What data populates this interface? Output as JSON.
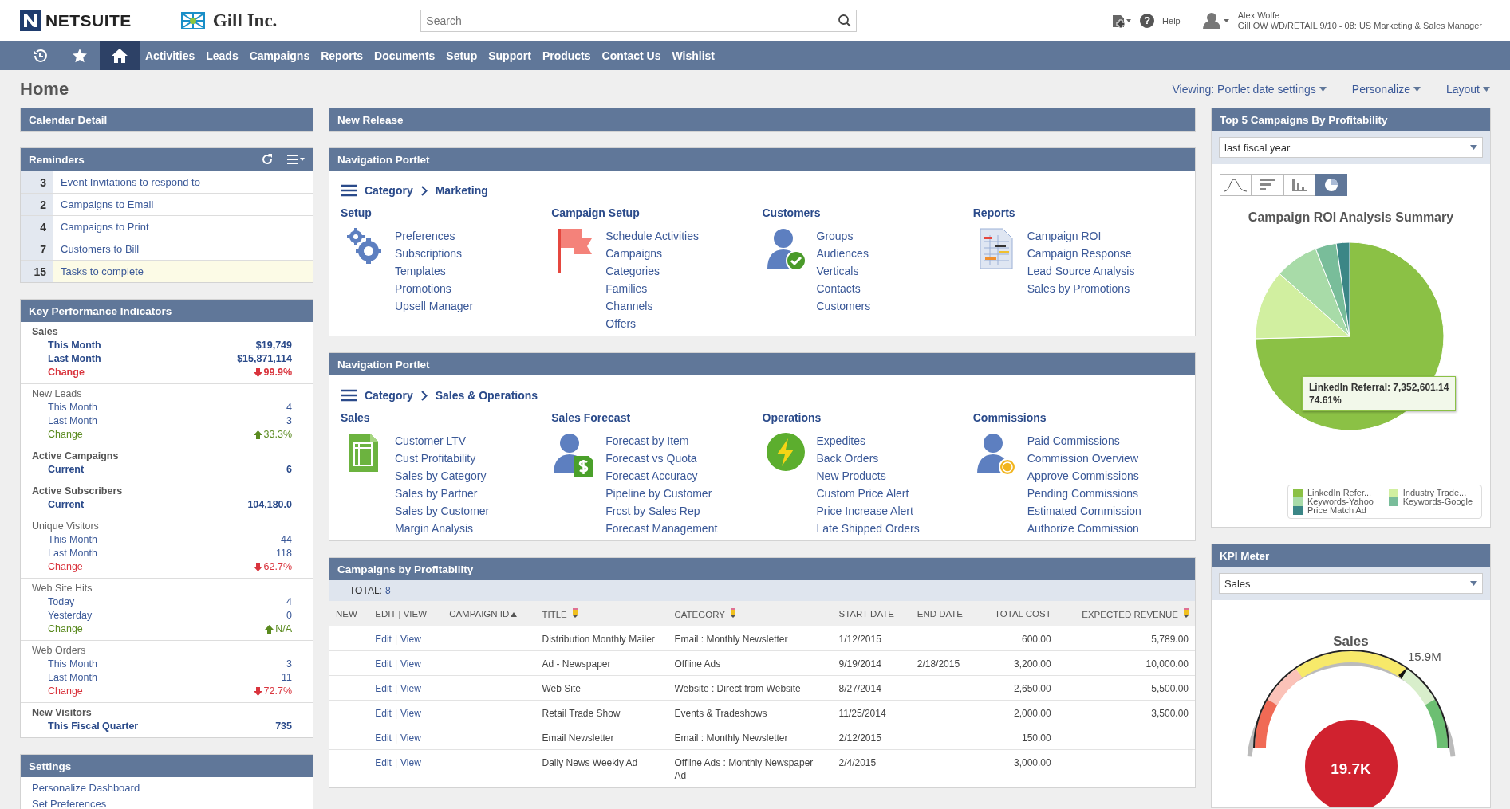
{
  "header": {
    "brand": "NETSUITE",
    "company": "Gill Inc.",
    "search": {
      "placeholder": "Search"
    },
    "help_icon": "?",
    "help": "Help",
    "user": {
      "name": "Alex Wolfe",
      "role": "Gill OW WD/RETAIL 9/10 - 08: US Marketing & Sales Manager"
    }
  },
  "nav": {
    "icons": [
      {
        "kind": "recent",
        "selected": false
      },
      {
        "kind": "favorites",
        "selected": false
      },
      {
        "kind": "home",
        "selected": true
      }
    ],
    "items": [
      {
        "label": "Activities",
        "selected": false
      },
      {
        "label": "Leads",
        "selected": false
      },
      {
        "label": "Campaigns",
        "selected": false
      },
      {
        "label": "Reports",
        "selected": false
      },
      {
        "label": "Documents",
        "selected": false
      },
      {
        "label": "Setup",
        "selected": false
      },
      {
        "label": "Support",
        "selected": false
      },
      {
        "label": "Products",
        "selected": false
      },
      {
        "label": "Contact Us",
        "selected": false
      },
      {
        "label": "Wishlist",
        "selected": false
      }
    ]
  },
  "page": {
    "title": "Home",
    "links": [
      "Viewing: Portlet date settings",
      "Personalize",
      "Layout"
    ]
  },
  "calendar": {
    "title": "Calendar Detail"
  },
  "reminders": {
    "title": "Reminders",
    "items": [
      {
        "count": "3",
        "label": "Event Invitations to respond to",
        "highlighted": false
      },
      {
        "count": "2",
        "label": "Campaigns to Email",
        "highlighted": false
      },
      {
        "count": "4",
        "label": "Campaigns to Print",
        "highlighted": false
      },
      {
        "count": "7",
        "label": "Customers to Bill",
        "highlighted": false
      },
      {
        "count": "15",
        "label": "Tasks to complete",
        "highlighted": true
      }
    ]
  },
  "kpi": {
    "title": "Key Performance Indicators",
    "groups": [
      {
        "title": "Sales",
        "emphasis": true,
        "rows": [
          {
            "label": "This Month",
            "value": "$19,749"
          },
          {
            "label": "Last Month",
            "value": "$15,871,114"
          },
          {
            "label": "Change",
            "value": "99.9%",
            "kind": "down"
          }
        ]
      },
      {
        "title": "New Leads",
        "emphasis": false,
        "rows": [
          {
            "label": "This Month",
            "value": "4"
          },
          {
            "label": "Last Month",
            "value": "3"
          },
          {
            "label": "Change",
            "value": "33.3%",
            "kind": "up"
          }
        ]
      },
      {
        "title": "Active Campaigns",
        "emphasis": true,
        "rows": [
          {
            "label": "Current",
            "value": "6"
          }
        ]
      },
      {
        "title": "Active Subscribers",
        "emphasis": true,
        "rows": [
          {
            "label": "Current",
            "value": "104,180.0"
          }
        ]
      },
      {
        "title": "Unique Visitors",
        "emphasis": false,
        "rows": [
          {
            "label": "This Month",
            "value": "44"
          },
          {
            "label": "Last Month",
            "value": "118"
          },
          {
            "label": "Change",
            "value": "62.7%",
            "kind": "down"
          }
        ]
      },
      {
        "title": "Web Site Hits",
        "emphasis": false,
        "rows": [
          {
            "label": "Today",
            "value": "4"
          },
          {
            "label": "Yesterday",
            "value": "0"
          },
          {
            "label": "Change",
            "value": "N/A",
            "kind": "up"
          }
        ]
      },
      {
        "title": "Web Orders",
        "emphasis": false,
        "rows": [
          {
            "label": "This Month",
            "value": "3"
          },
          {
            "label": "Last Month",
            "value": "11"
          },
          {
            "label": "Change",
            "value": "72.7%",
            "kind": "down"
          }
        ]
      },
      {
        "title": "New Visitors",
        "emphasis": true,
        "rows": [
          {
            "label": "This Fiscal Quarter",
            "value": "735"
          }
        ]
      }
    ]
  },
  "settings": {
    "title": "Settings",
    "links": [
      "Personalize Dashboard",
      "Set Preferences"
    ]
  },
  "new_release": {
    "title": "New Release"
  },
  "navigation_portlets": [
    {
      "title": "Navigation Portlet",
      "breadcrumb": [
        "Category",
        "Marketing"
      ],
      "sections": [
        {
          "title": "Setup",
          "kind": "gears",
          "links": [
            "Preferences",
            "Subscriptions",
            "Templates",
            "Promotions",
            "Upsell Manager"
          ]
        },
        {
          "title": "Campaign Setup",
          "kind": "flag",
          "links": [
            "Schedule Activities",
            "Campaigns",
            "Categories",
            "Families",
            "Channels",
            "Offers"
          ]
        },
        {
          "title": "Customers",
          "kind": "person-check",
          "links": [
            "Groups",
            "Audiences",
            "Verticals",
            "Contacts",
            "Customers"
          ]
        },
        {
          "title": "Reports",
          "kind": "report",
          "links": [
            "Campaign ROI",
            "Campaign Response",
            "Lead Source Analysis",
            "Sales by Promotions"
          ]
        }
      ]
    },
    {
      "title": "Navigation Portlet",
      "breadcrumb": [
        "Category",
        "Sales & Operations"
      ],
      "sections": [
        {
          "title": "Sales",
          "kind": "sheet",
          "links": [
            "Customer LTV",
            "Cust Profitability",
            "Sales by Category",
            "Sales by Partner",
            "Sales by Customer",
            "Margin Analysis"
          ]
        },
        {
          "title": "Sales Forecast",
          "kind": "person-dollar",
          "links": [
            "Forecast by Item",
            "Forecast vs Quota",
            "Forecast Accuracy",
            "Pipeline by Customer",
            "Frcst by Sales Rep",
            "Forecast Management"
          ]
        },
        {
          "title": "Operations",
          "kind": "lightning",
          "links": [
            "Expedites",
            "Back Orders",
            "New Products",
            "Custom Price Alert",
            "Price Increase Alert",
            "Late Shipped Orders"
          ]
        },
        {
          "title": "Commissions",
          "kind": "person-coin",
          "links": [
            "Paid Commissions",
            "Commission Overview",
            "Approve Commissions",
            "Pending Commissions",
            "Estimated Commission",
            "Authorize Commission"
          ]
        }
      ]
    }
  ],
  "campaigns_table": {
    "title": "Campaigns by Profitability",
    "total_label": "TOTAL:",
    "total": "8",
    "action_separator": "|",
    "columns": [
      {
        "label": "NEW",
        "kind": "text"
      },
      {
        "label": "EDIT | VIEW",
        "kind": "text"
      },
      {
        "label": "CAMPAIGN ID",
        "kind": "text",
        "sorted": true
      },
      {
        "label": "TITLE",
        "kind": "text",
        "editable": true
      },
      {
        "label": "CATEGORY",
        "kind": "text",
        "editable": true
      },
      {
        "label": "START DATE",
        "kind": "text"
      },
      {
        "label": "END DATE",
        "kind": "text"
      },
      {
        "label": "TOTAL COST",
        "kind": "number"
      },
      {
        "label": "EXPECTED REVENUE",
        "kind": "number",
        "editable": true
      }
    ],
    "rows": [
      {
        "actions": [
          "Edit",
          "View"
        ],
        "title": "Distribution Monthly Mailer",
        "category": "Email : Monthly Newsletter",
        "start_date": "1/12/2015",
        "total_cost": "600.00",
        "expected_revenue": "5,789.00"
      },
      {
        "actions": [
          "Edit",
          "View"
        ],
        "title": "Ad - Newspaper",
        "category": "Offline Ads",
        "start_date": "9/19/2014",
        "end_date": "2/18/2015",
        "total_cost": "3,200.00",
        "expected_revenue": "10,000.00"
      },
      {
        "actions": [
          "Edit",
          "View"
        ],
        "title": "Web Site",
        "category": "Website : Direct from Website",
        "start_date": "8/27/2014",
        "total_cost": "2,650.00",
        "expected_revenue": "5,500.00"
      },
      {
        "actions": [
          "Edit",
          "View"
        ],
        "title": "Retail Trade Show",
        "category": "Events & Tradeshows",
        "start_date": "11/25/2014",
        "total_cost": "2,000.00",
        "expected_revenue": "3,500.00"
      },
      {
        "actions": [
          "Edit",
          "View"
        ],
        "title": "Email Newsletter",
        "category": "Email : Monthly Newsletter",
        "start_date": "2/12/2015",
        "total_cost": "150.00"
      },
      {
        "actions": [
          "Edit",
          "View"
        ],
        "title": "Daily News Weekly Ad",
        "category": "Offline Ads : Monthly Newspaper Ad",
        "start_date": "2/4/2015",
        "total_cost": "3,000.00"
      }
    ]
  },
  "top_campaigns": {
    "title": "Top 5 Campaigns By Profitability",
    "period": "last fiscal year",
    "chart_types": [
      {
        "kind": "line",
        "selected": false
      },
      {
        "kind": "hbar",
        "selected": false
      },
      {
        "kind": "bar",
        "selected": false
      },
      {
        "kind": "pie",
        "selected": true
      }
    ],
    "chart_title": "Campaign ROI Analysis Summary",
    "tooltip": [
      "LinkedIn Referral: 7,352,601.14",
      "74.61%"
    ],
    "legend": [
      {
        "label": "LinkedIn Refer...",
        "color": "#8bc145"
      },
      {
        "label": "Industry Trade...",
        "color": "#d1efa0"
      },
      {
        "label": "Keywords-Yahoo",
        "color": "#a8dba8"
      },
      {
        "label": "Keywords-Google",
        "color": "#79bd9a"
      },
      {
        "label": "Price Match Ad",
        "color": "#3b8686"
      }
    ]
  },
  "kpi_meter": {
    "title": "KPI Meter",
    "metric": "Sales",
    "gauge_title": "Sales",
    "target": "15.9M",
    "value": "19.7K"
  }
}
